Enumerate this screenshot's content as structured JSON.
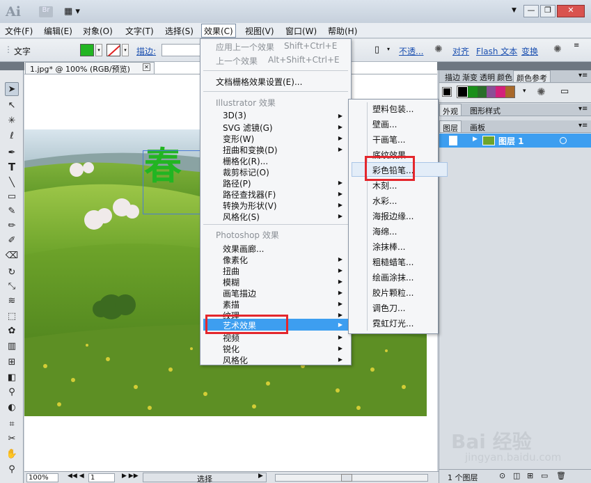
{
  "app": {
    "logo": "Ai",
    "bridge": "Br"
  },
  "window": {
    "minimize": "—",
    "restore": "❐",
    "close": "✕"
  },
  "menubar": [
    "文件(F)",
    "编辑(E)",
    "对象(O)",
    "文字(T)",
    "选择(S)",
    "效果(C)",
    "视图(V)",
    "窗口(W)",
    "帮助(H)"
  ],
  "control": {
    "type_label": "文字",
    "stroke_label": "描边:",
    "opacity_label": "不透...",
    "align_label": "对齐",
    "flash_label": "Flash 文本",
    "transform_label": "变换",
    "fill_color": "#22b522"
  },
  "document": {
    "tab_title": "1.jpg* @ 100% (RGB/预览)",
    "text_overlay": "春"
  },
  "effects_menu": {
    "top": [
      {
        "label": "应用上一个效果",
        "shortcut": "Shift+Ctrl+E",
        "disabled": true
      },
      {
        "label": "上一个效果",
        "shortcut": "Alt+Shift+Ctrl+E",
        "disabled": true
      }
    ],
    "doc_settings": "文档栅格效果设置(E)...",
    "illustrator_header": "Illustrator 效果",
    "illustrator_items": [
      "3D(3)",
      "SVG 滤镜(G)",
      "变形(W)",
      "扭曲和变换(D)",
      "栅格化(R)...",
      "裁剪标记(O)",
      "路径(P)",
      "路径查找器(F)",
      "转换为形状(V)",
      "风格化(S)"
    ],
    "photoshop_header": "Photoshop 效果",
    "photoshop_items": [
      "效果画廊...",
      "像素化",
      "扭曲",
      "模糊",
      "画笔描边",
      "素描",
      "纹理",
      "艺术效果",
      "视频",
      "锐化",
      "风格化"
    ]
  },
  "artistic_submenu": [
    "塑料包装...",
    "壁画...",
    "干画笔...",
    "底纹效果...",
    "彩色铅笔...",
    "木刻...",
    "水彩...",
    "海报边缘...",
    "海绵...",
    "涂抹棒...",
    "粗糙蜡笔...",
    "绘画涂抹...",
    "胶片颗粒...",
    "调色刀...",
    "霓虹灯光..."
  ],
  "panels": {
    "tabs_top": [
      "描边",
      "渐变",
      "透明",
      "颜色",
      "颜色参考"
    ],
    "tabs_mid": [
      "外观",
      "图形样式"
    ],
    "tabs_layers": [
      "图层",
      "画板"
    ],
    "layer_name": "图层 1",
    "layer_count": "1 个图层",
    "swatches": [
      "#000000",
      "#1a8f1a",
      "#2a6e2a",
      "#8b4e96",
      "#d4207a",
      "#a8682a"
    ]
  },
  "status": {
    "zoom": "100%",
    "page": "1",
    "mode": "选择"
  },
  "watermark": {
    "logo": "Bai 经验",
    "url": "jingyan.baidu.com"
  }
}
